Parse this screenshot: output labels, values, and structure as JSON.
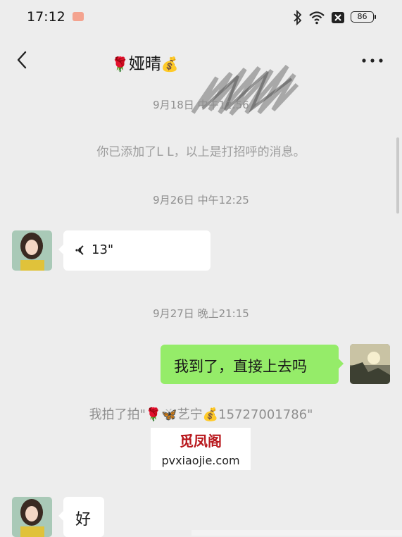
{
  "status_bar": {
    "time": "17:12",
    "battery": "86",
    "icons": [
      "app-notification-icon",
      "bluetooth-icon",
      "wifi-icon",
      "sim-off-icon",
      "battery-icon"
    ]
  },
  "nav": {
    "title_prefix": "🌹",
    "title_name": "娅晴",
    "title_suffix": "💰",
    "icons": [
      "back-arrow-icon",
      "more-dots-icon"
    ]
  },
  "messages": {
    "time1": "9月18日 中午12:56",
    "system_added": "你已添加了L L，以上是打招呼的消息。",
    "time2": "9月26日 中午12:25",
    "voice_duration": "13\"",
    "time3": "9月27日 晚上21:15",
    "sent_text": "我到了，直接上去吗",
    "pat_text": "我拍了拍\"🌹🦋艺宁💰15727001786\"",
    "reply_text": "好"
  },
  "watermark": {
    "line1": "觅凤阁",
    "line2": "pvxiaojie.com"
  },
  "colors": {
    "background": "#ededed",
    "sent_bubble": "#95ec69",
    "received_bubble": "#ffffff",
    "watermark_red": "#b8171c"
  }
}
